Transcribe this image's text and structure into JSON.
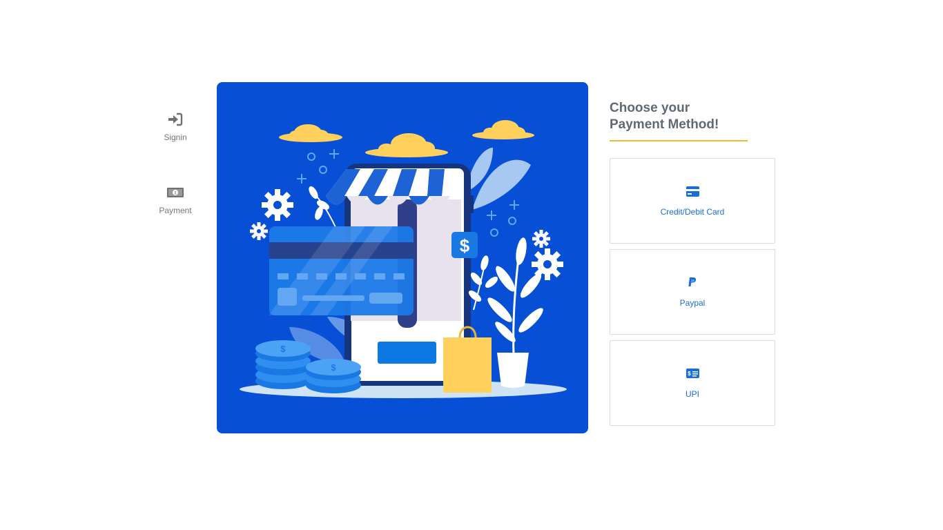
{
  "steps": [
    {
      "label": "Signin",
      "icon": "sign-in-icon"
    },
    {
      "label": "Payment",
      "icon": "money-bill-icon"
    }
  ],
  "hero": {
    "illustration": "online-shop-payment-illustration",
    "background": "#0750d6"
  },
  "panel": {
    "title": "Choose your Payment Method!",
    "accent_color": "#f5b82e",
    "methods": [
      {
        "label": "Credit/Debit Card",
        "icon": "credit-card-icon"
      },
      {
        "label": "Paypal",
        "icon": "paypal-icon"
      },
      {
        "label": "UPI",
        "icon": "money-check-icon"
      }
    ]
  },
  "colors": {
    "link": "#1a6fd6",
    "muted": "#777777"
  }
}
